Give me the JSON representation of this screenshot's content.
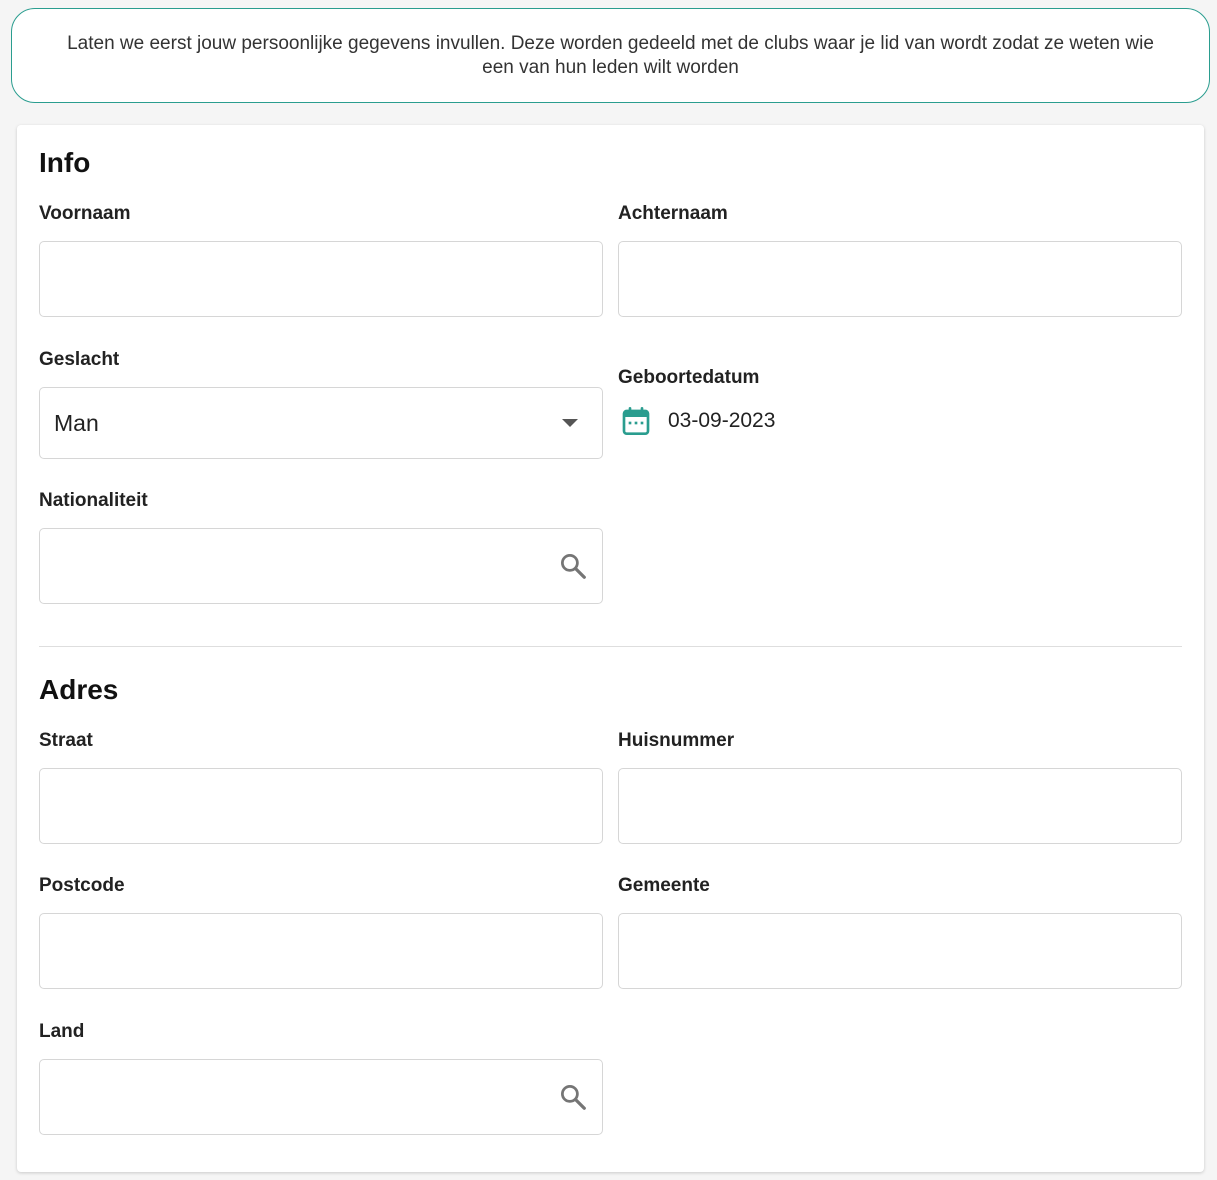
{
  "banner": {
    "text": "Laten we eerst jouw persoonlijke gegevens invullen. Deze worden gedeeld met de clubs waar je lid van wordt zodat ze weten wie een van hun leden wilt worden"
  },
  "info": {
    "title": "Info",
    "firstname_label": "Voornaam",
    "firstname_value": "",
    "lastname_label": "Achternaam",
    "lastname_value": "",
    "gender_label": "Geslacht",
    "gender_value": "Man",
    "birthdate_label": "Geboortedatum",
    "birthdate_value": "03-09-2023",
    "nationality_label": "Nationaliteit",
    "nationality_value": ""
  },
  "address": {
    "title": "Adres",
    "street_label": "Straat",
    "street_value": "",
    "number_label": "Huisnummer",
    "number_value": "",
    "postcode_label": "Postcode",
    "postcode_value": "",
    "city_label": "Gemeente",
    "city_value": "",
    "country_label": "Land",
    "country_value": ""
  },
  "colors": {
    "accent": "#2a9d8f",
    "border": "#d6d6d6"
  },
  "icons": {
    "dropdown": "chevron-down-icon",
    "search": "search-icon",
    "calendar": "calendar-icon"
  }
}
